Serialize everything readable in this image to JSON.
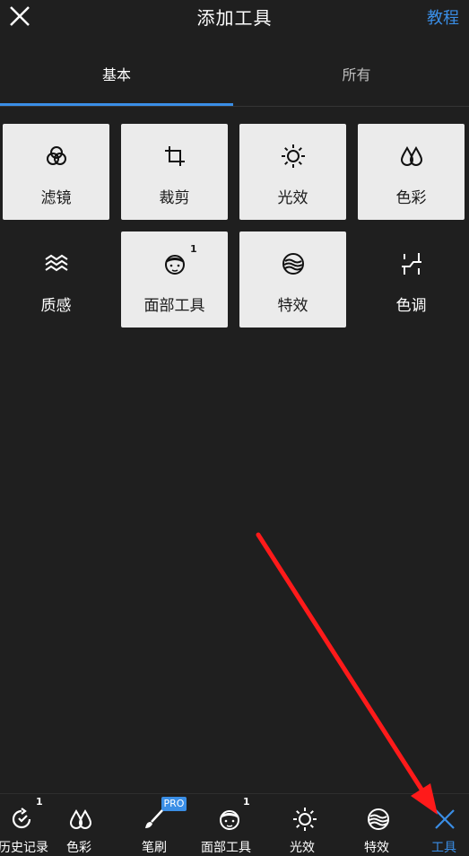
{
  "header": {
    "title": "添加工具",
    "tutorial_label": "教程"
  },
  "tabs": [
    {
      "label": "基本",
      "active": true
    },
    {
      "label": "所有",
      "active": false
    }
  ],
  "tools": [
    {
      "label": "滤镜",
      "icon": "filter-icon"
    },
    {
      "label": "裁剪",
      "icon": "crop-icon"
    },
    {
      "label": "光效",
      "icon": "light-icon"
    },
    {
      "label": "色彩",
      "icon": "color-icon"
    },
    {
      "label": "质感",
      "icon": "texture-icon"
    },
    {
      "label": "面部工具",
      "icon": "face-tool-icon",
      "badge": "1"
    },
    {
      "label": "特效",
      "icon": "effects-icon"
    },
    {
      "label": "色调",
      "icon": "tone-icon"
    }
  ],
  "bottom_bar": [
    {
      "label": "历史记录",
      "icon": "history-icon",
      "badge": "1"
    },
    {
      "label": "色彩",
      "icon": "color-icon"
    },
    {
      "label": "笔刷",
      "icon": "brush-icon",
      "badge": "PRO"
    },
    {
      "label": "面部工具",
      "icon": "face-tool-icon",
      "badge": "1"
    },
    {
      "label": "光效",
      "icon": "light-icon"
    },
    {
      "label": "特效",
      "icon": "effects-icon"
    },
    {
      "label": "工具",
      "icon": "close-icon",
      "active": true
    }
  ],
  "colors": {
    "accent": "#3a8ee6",
    "background": "#1f1f1f",
    "tile_light": "#ebebeb",
    "annotation_arrow": "#ff1a1a"
  }
}
